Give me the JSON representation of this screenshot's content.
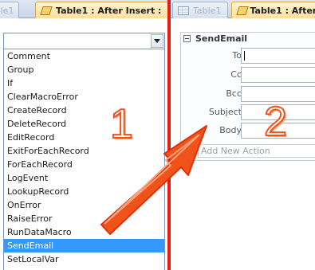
{
  "left_pane": {
    "tabs": [
      {
        "label": "Table1",
        "active": false,
        "icon": "table-icon"
      },
      {
        "label": "Table1 : After Insert :",
        "active": true,
        "icon": "macro-icon"
      }
    ],
    "combo": {
      "value": ""
    },
    "action_list": [
      "Comment",
      "Group",
      "If",
      "ClearMacroError",
      "CreateRecord",
      "DeleteRecord",
      "EditRecord",
      "ExitForEachRecord",
      "ForEachRecord",
      "LogEvent",
      "LookupRecord",
      "OnError",
      "RaiseError",
      "RunDataMacro",
      "SendEmail",
      "SetLocalVar"
    ],
    "selected_action": "SendEmail",
    "callout_number": "1"
  },
  "right_pane": {
    "tabs": [
      {
        "label": "Table1",
        "active": false,
        "icon": "table-icon"
      },
      {
        "label": "Table1 : After In",
        "active": true,
        "icon": "macro-icon"
      }
    ],
    "action": {
      "name": "SendEmail",
      "arguments": [
        {
          "label": "To",
          "value": ""
        },
        {
          "label": "Cc",
          "value": ""
        },
        {
          "label": "Bcc",
          "value": ""
        },
        {
          "label": "Subject",
          "value": ""
        },
        {
          "label": "Body",
          "value": ""
        }
      ]
    },
    "add_new_action_placeholder": "Add New Action",
    "callout_number": "2"
  },
  "colors": {
    "divider": "#e41e14",
    "arrow_fill": "#f0531a",
    "selection": "#3399ff",
    "active_tab": "#fde19a"
  }
}
